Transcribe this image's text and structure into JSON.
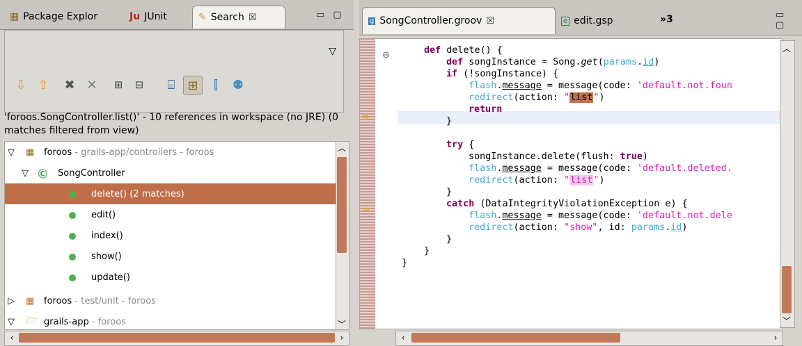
{
  "left_view": {
    "tabs": [
      {
        "label": "Package Explor",
        "icon": "package-icon"
      },
      {
        "label": "JUnit",
        "icon": "junit-icon"
      },
      {
        "label": "Search",
        "icon": "search-flashlight-icon",
        "close": "☒"
      }
    ],
    "window_controls": "▭ ▢",
    "summary": "'foroos.SongController.list()' - 10 references in workspace (no JRE) (0 matches filtered from view)",
    "tree": [
      {
        "expander": "▽",
        "label": "foroos",
        "suffix": " - grails-app/controllers - foroos",
        "icon": "package-icon"
      },
      {
        "expander": "▽",
        "label": "SongController",
        "suffix": "",
        "icon": "class-icon"
      },
      {
        "expander": "",
        "label": "delete() (2 matches)",
        "suffix": "",
        "icon": "method-icon",
        "selected": true
      },
      {
        "expander": "",
        "label": "edit()",
        "suffix": "",
        "icon": "method-icon"
      },
      {
        "expander": "",
        "label": "index()",
        "suffix": "",
        "icon": "method-icon"
      },
      {
        "expander": "",
        "label": "show()",
        "suffix": "",
        "icon": "method-icon"
      },
      {
        "expander": "",
        "label": "update()",
        "suffix": "",
        "icon": "method-icon"
      },
      {
        "expander": "▷",
        "label": "foroos",
        "suffix": " - test/unit - foroos",
        "icon": "package-icon"
      },
      {
        "expander": "▽",
        "label": "grails-app",
        "suffix": " - foroos",
        "icon": "folder-icon"
      }
    ]
  },
  "editor": {
    "tabs": [
      {
        "label": "SongController.groov",
        "close": "☒",
        "icon": "groovy-file-icon"
      },
      {
        "label": "edit.gsp",
        "icon": "gsp-file-icon"
      },
      {
        "label": "»3",
        "icon": "overflow-icon"
      }
    ],
    "window_controls": "▭ ▢"
  }
}
